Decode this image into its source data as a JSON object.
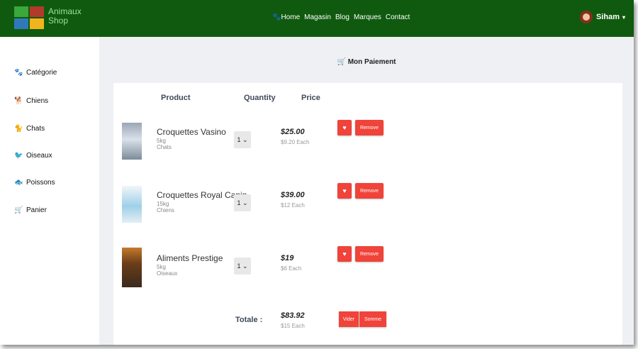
{
  "brand": {
    "line1": "Animaux",
    "line2": "Shop"
  },
  "nav": {
    "home_icon": "paw-icon",
    "home": "Home",
    "magasin": "Magasin",
    "blog": "Blog",
    "marques": "Marques",
    "contact": "Contact"
  },
  "user": {
    "name": "Siham",
    "caret": "▾"
  },
  "sidebar": {
    "items": [
      {
        "icon": "paw-icon",
        "glyph": "🐾",
        "label": "Catégorie"
      },
      {
        "icon": "dog-icon",
        "glyph": "🐕",
        "label": "Chiens"
      },
      {
        "icon": "cat-icon",
        "glyph": "🐈",
        "label": "Chats"
      },
      {
        "icon": "bird-icon",
        "glyph": "🐦",
        "label": "Oiseaux"
      },
      {
        "icon": "fish-icon",
        "glyph": "🐟",
        "label": "Poissons"
      },
      {
        "icon": "cart-icon",
        "glyph": "🛒",
        "label": "Panier"
      }
    ]
  },
  "main": {
    "title": "Mon Paiement",
    "title_icon": "cart-icon"
  },
  "table": {
    "headers": {
      "product": "Product",
      "quantity": "Quantity",
      "price": "Price"
    },
    "rows": [
      {
        "name": "Croquettes Vasino",
        "weight": "5kg",
        "category": "Chats",
        "qty": "1",
        "price": "$25.00",
        "each": "$9.20 Each",
        "remove": "Remove",
        "thumb_color": "#c8d4e0"
      },
      {
        "name": "Croquettes Royal Canin",
        "weight": "15kg",
        "category": "Chiens",
        "qty": "1",
        "price": "$39.00",
        "each": "$12 Each",
        "remove": "Remove",
        "thumb_color": "#e4f1f8"
      },
      {
        "name": "Aliments Prestige",
        "weight": "5kg",
        "category": "Oiseaux",
        "qty": "1",
        "price": "$19",
        "each": "$6 Each",
        "remove": "Remove",
        "thumb_color": "#b36a24"
      }
    ]
  },
  "totals": {
    "label": "Totale :",
    "value": "$83.92",
    "each": "$15 Each",
    "vider": "Vider",
    "somme": "Somme"
  },
  "colors": {
    "nav": "#0f5a0f",
    "accent": "#f0433a",
    "main_bg": "#eef0f3"
  }
}
